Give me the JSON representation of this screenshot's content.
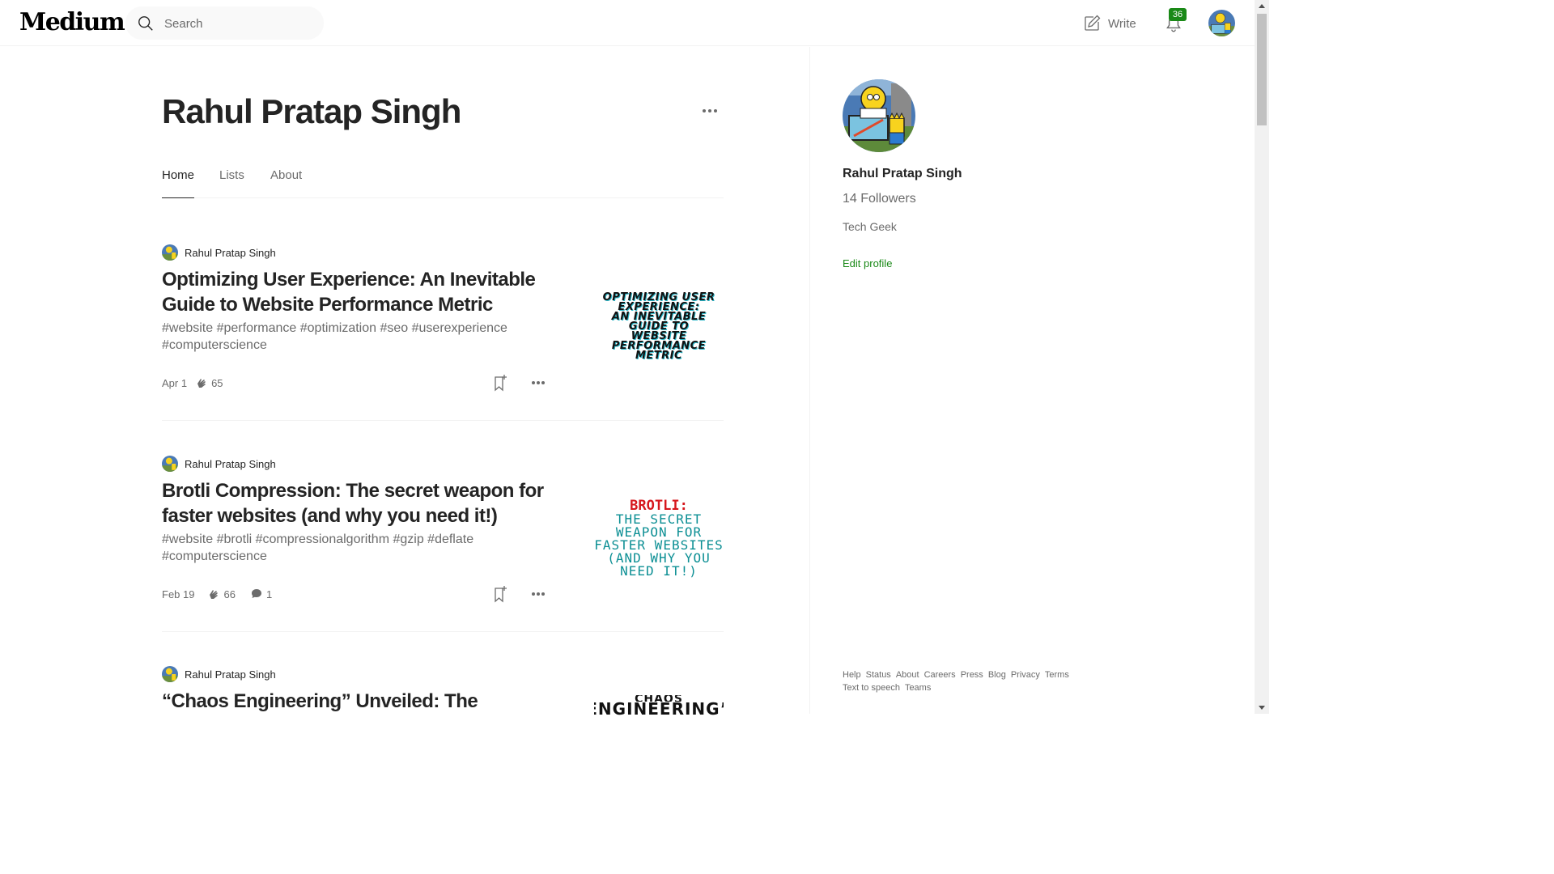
{
  "header": {
    "logo": "Medium",
    "search_placeholder": "Search",
    "write_label": "Write",
    "notification_count": "36"
  },
  "profile": {
    "name": "Rahul Pratap Singh",
    "tabs": [
      {
        "label": "Home",
        "active": true
      },
      {
        "label": "Lists",
        "active": false
      },
      {
        "label": "About",
        "active": false
      }
    ]
  },
  "articles": [
    {
      "author": "Rahul Pratap Singh",
      "title": "Optimizing User Experience: An Inevitable Guide to Website Performance Metric",
      "subtitle": "#website #performance #optimization #seo #userexperience #computerscience",
      "date": "Apr 1",
      "claps": "65",
      "comments": "",
      "thumb_text": [
        "OPTIMIZING USER",
        "EXPERIENCE:",
        "AN INEVITABLE GUIDE TO",
        "WEBSITE PERFORMANCE",
        "METRIC"
      ]
    },
    {
      "author": "Rahul Pratap Singh",
      "title": "Brotli Compression: The secret weapon for faster websites (and why you need it!)",
      "subtitle": "#website #brotli #compressionalgorithm #gzip #deflate #computerscience",
      "date": "Feb 19",
      "claps": "66",
      "comments": "1",
      "thumb_text": [
        "BROTLI:",
        "THE SECRET",
        "WEAPON FOR",
        "FASTER WEBSITES",
        "(AND WHY YOU",
        "NEED IT!)"
      ]
    },
    {
      "author": "Rahul Pratap Singh",
      "title": "“Chaos Engineering” Unveiled: The",
      "thumb_text": [
        "CHAOS",
        "ENGINEERING”"
      ]
    }
  ],
  "sidebar": {
    "name": "Rahul Pratap Singh",
    "followers": "14 Followers",
    "bio": "Tech Geek",
    "edit_label": "Edit profile",
    "footer_links": [
      "Help",
      "Status",
      "About",
      "Careers",
      "Press",
      "Blog",
      "Privacy",
      "Terms",
      "Text to speech",
      "Teams"
    ]
  },
  "colors": {
    "accent_green": "#1a8917",
    "text_primary": "#242424",
    "text_secondary": "#6b6b6b",
    "brotli_red": "#d6171d",
    "brotli_teal": "#0c8f94"
  }
}
